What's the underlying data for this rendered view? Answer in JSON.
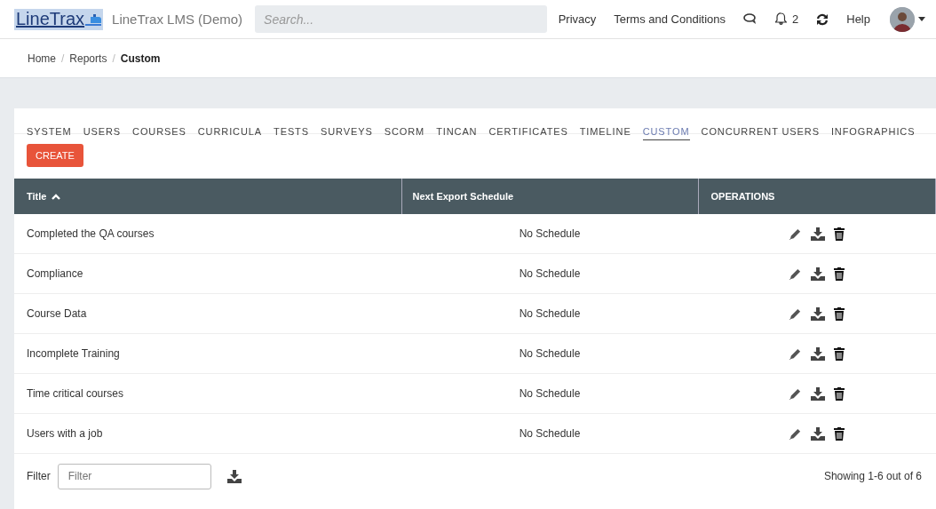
{
  "header": {
    "logo": "LineTrax",
    "app_name": "LineTrax LMS (Demo)",
    "search": {
      "placeholder": "Search..."
    },
    "links": [
      "Privacy",
      "Terms and Conditions"
    ],
    "notifications": {
      "count": "2"
    },
    "help": "Help"
  },
  "breadcrumb": [
    {
      "label": "Home",
      "current": false
    },
    {
      "separator": "/",
      "label": "Reports",
      "current": false
    },
    {
      "separator": "/",
      "label": "Custom",
      "current": true
    }
  ],
  "tabs": [
    {
      "label": "SYSTEM",
      "selected": false
    },
    {
      "label": "USERS",
      "selected": false
    },
    {
      "label": "COURSES",
      "selected": false
    },
    {
      "label": "CURRICULA",
      "selected": false
    },
    {
      "label": "TESTS",
      "selected": false
    },
    {
      "label": "SURVEYS",
      "selected": false
    },
    {
      "label": "SCORM",
      "selected": false
    },
    {
      "label": "TINCAN",
      "selected": false
    },
    {
      "label": "CERTIFICATES",
      "selected": false
    },
    {
      "label": "TIMELINE",
      "selected": false
    },
    {
      "label": "CUSTOM",
      "selected": true
    },
    {
      "label": "CONCURRENT USERS",
      "selected": false
    },
    {
      "label": "INFOGRAPHICS",
      "selected": false
    }
  ],
  "create_button": "CREATE",
  "table": {
    "columns": [
      {
        "label": "Title",
        "sorted_ascending": true
      },
      {
        "label": "Next Export Schedule",
        "sorted_ascending": false
      },
      {
        "label": "OPERATIONS",
        "sorted_ascending": false
      }
    ],
    "rows": [
      {
        "title": "Completed the QA courses",
        "schedule": "No Schedule"
      },
      {
        "title": "Compliance",
        "schedule": "No Schedule"
      },
      {
        "title": "Course Data",
        "schedule": "No Schedule"
      },
      {
        "title": "Incomplete Training",
        "schedule": "No Schedule"
      },
      {
        "title": "Time critical courses",
        "schedule": "No Schedule"
      },
      {
        "title": "Users with a job",
        "schedule": "No Schedule"
      }
    ]
  },
  "footer": {
    "filter_label": "Filter",
    "filter": {
      "placeholder": "Filter"
    },
    "showing": "Showing 1-6 out of 6"
  }
}
